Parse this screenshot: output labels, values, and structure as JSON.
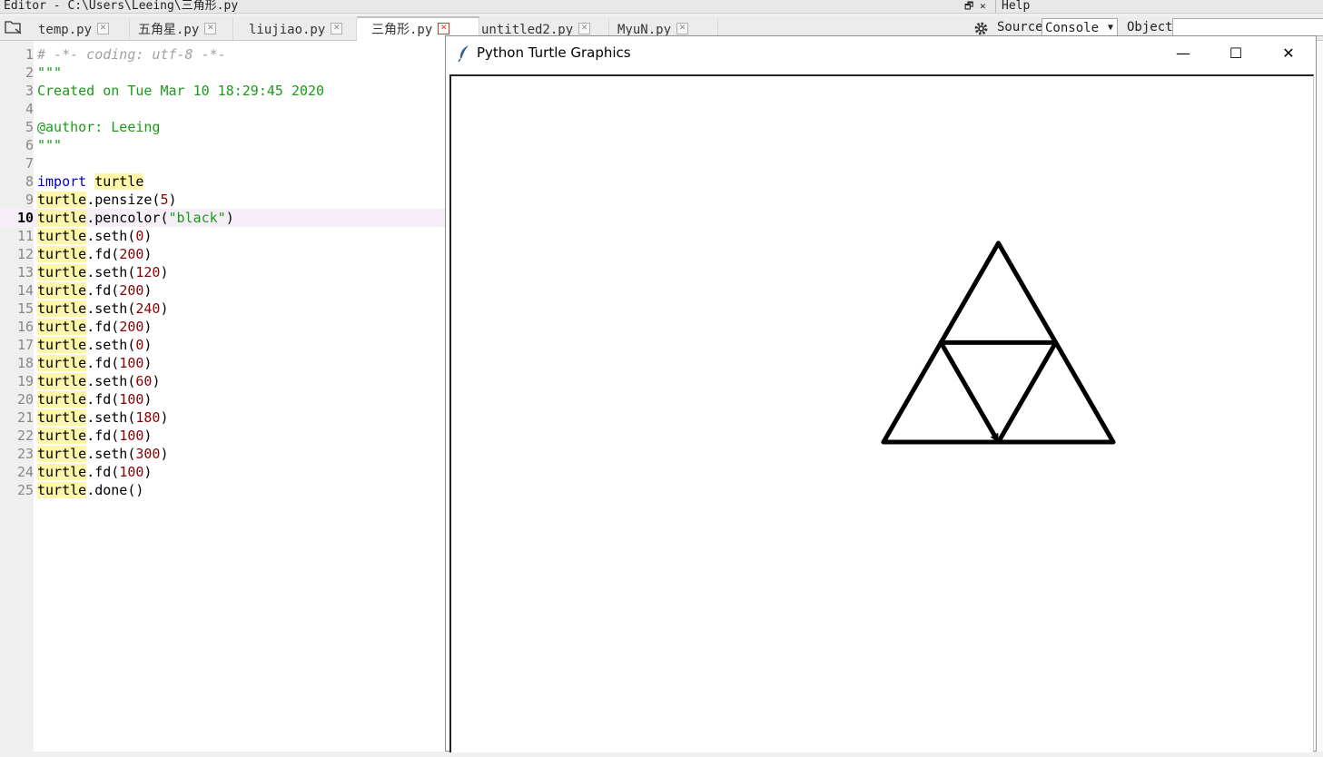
{
  "topbar": {
    "title": "Editor - C:\\Users\\Leeing\\三角形.py",
    "window_controls": "🗗 ✕",
    "help_menu": "Help"
  },
  "tabs": [
    {
      "label": "temp.py",
      "active": false
    },
    {
      "label": "五角星.py",
      "active": false
    },
    {
      "label": "liujiao.py",
      "active": false
    },
    {
      "label": "三角形.py",
      "active": true
    },
    {
      "label": "untitled2.py",
      "active": false
    },
    {
      "label": "MyuN.py",
      "active": false
    }
  ],
  "help_pane": {
    "source_label": "Source",
    "source_value": "Console",
    "object_label": "Object",
    "object_value": ""
  },
  "editor": {
    "current_line": 10,
    "lines": [
      "# -*- coding: utf-8 -*-",
      "\"\"\"",
      "Created on Tue Mar 10 18:29:45 2020",
      "",
      "@author: Leeing",
      "\"\"\"",
      "",
      "import turtle",
      "turtle.pensize(5)",
      "turtle.pencolor(\"black\")",
      "turtle.seth(0)",
      "turtle.fd(200)",
      "turtle.seth(120)",
      "turtle.fd(200)",
      "turtle.seth(240)",
      "turtle.fd(200)",
      "turtle.seth(0)",
      "turtle.fd(100)",
      "turtle.seth(60)",
      "turtle.fd(100)",
      "turtle.seth(180)",
      "turtle.fd(100)",
      "turtle.seth(300)",
      "turtle.fd(100)",
      "turtle.done()"
    ]
  },
  "turtle_window": {
    "title": "Python Turtle Graphics",
    "minimize": "—",
    "maximize": "☐",
    "close": "✕",
    "pen_size": 5,
    "pen_color": "#000000",
    "drawing_steps": [
      {
        "heading": 0,
        "distance": 200
      },
      {
        "heading": 120,
        "distance": 200
      },
      {
        "heading": 240,
        "distance": 200
      },
      {
        "heading": 0,
        "distance": 100
      },
      {
        "heading": 60,
        "distance": 100
      },
      {
        "heading": 180,
        "distance": 100
      },
      {
        "heading": 300,
        "distance": 100
      }
    ]
  },
  "colors": {
    "comment": "#a0a0a0",
    "string": "#1a9a1a",
    "keyword": "#0000cc",
    "number": "#8b0000",
    "highlight": "#fdf6a8",
    "current_line": "#f5eef7"
  }
}
